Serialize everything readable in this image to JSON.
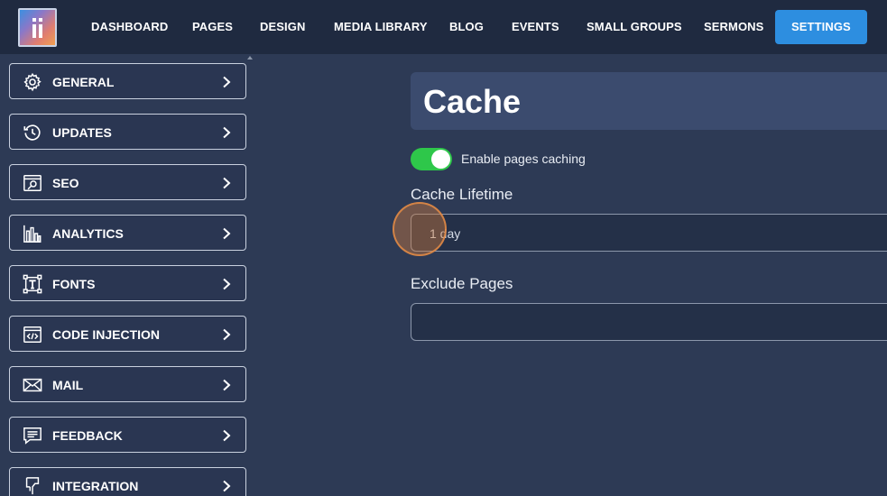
{
  "nav": {
    "items": [
      {
        "label": "DASHBOARD"
      },
      {
        "label": "PAGES"
      },
      {
        "label": "DESIGN"
      },
      {
        "label": "MEDIA LIBRARY"
      },
      {
        "label": "BLOG"
      },
      {
        "label": "EVENTS"
      },
      {
        "label": "SMALL GROUPS"
      },
      {
        "label": "SERMONS"
      },
      {
        "label": "SETTINGS",
        "active": true
      }
    ]
  },
  "sidebar": {
    "items": [
      {
        "label": "GENERAL",
        "icon": "gear-icon"
      },
      {
        "label": "UPDATES",
        "icon": "history-icon"
      },
      {
        "label": "SEO",
        "icon": "seo-browser-icon"
      },
      {
        "label": "ANALYTICS",
        "icon": "bar-chart-icon"
      },
      {
        "label": "FONTS",
        "icon": "font-icon"
      },
      {
        "label": "CODE INJECTION",
        "icon": "code-icon"
      },
      {
        "label": "MAIL",
        "icon": "envelope-icon"
      },
      {
        "label": "FEEDBACK",
        "icon": "feedback-icon"
      },
      {
        "label": "INTEGRATION",
        "icon": "plug-icon"
      }
    ]
  },
  "main": {
    "title": "Cache",
    "toggle": {
      "label": "Enable pages caching",
      "enabled": true
    },
    "cache_lifetime": {
      "label": "Cache Lifetime",
      "value": "1 day"
    },
    "exclude_pages": {
      "label": "Exclude Pages",
      "value": ""
    }
  },
  "colors": {
    "accent": "#2d8ee0",
    "toggle_on": "#2ec74a",
    "background": "#2d3a55",
    "topbar": "#1f2a40"
  }
}
